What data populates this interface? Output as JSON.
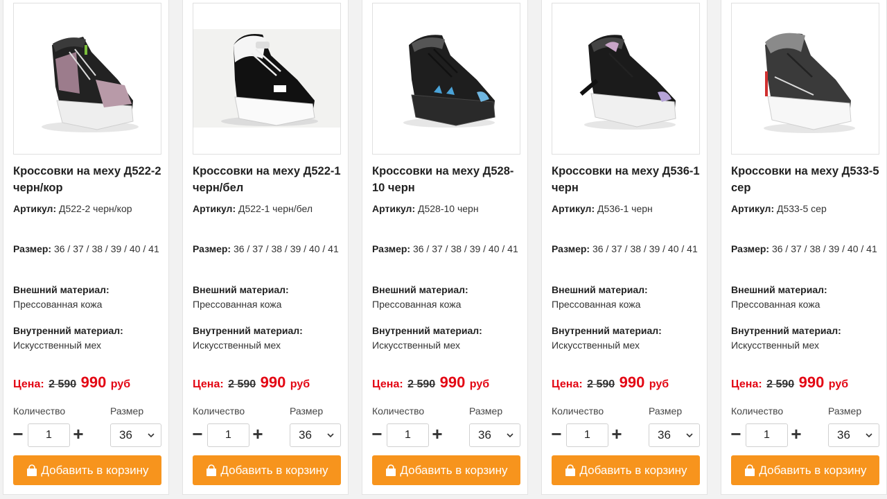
{
  "labels": {
    "article": "Артикул:",
    "size": "Размер:",
    "outer": "Внешний материал:",
    "inner": "Внутренний материал:",
    "price": "Цена:",
    "currency": "руб",
    "quantity": "Количество",
    "size_select": "Размер",
    "add_to_cart": "Добавить в корзину"
  },
  "colors": {
    "price": "#e30613",
    "button": "#f7941d"
  },
  "products": [
    {
      "title": "Кроссовки на меху Д522-2 черн/кор",
      "article": "Д522-2 черн/кор",
      "sizes": "36 / 37 / 38 / 39 / 40 / 41",
      "outer": "Прессованная кожа",
      "inner": "Искусственный мех",
      "old_price": "2 590",
      "new_price": "990",
      "quantity": "1",
      "selected_size": "36",
      "image_icon": "sneaker-photo"
    },
    {
      "title": "Кроссовки на меху Д522-1 черн/бел",
      "article": "Д522-1 черн/бел",
      "sizes": "36 / 37 / 38 / 39 / 40 / 41",
      "outer": "Прессованная кожа",
      "inner": "Искусственный мех",
      "old_price": "2 590",
      "new_price": "990",
      "quantity": "1",
      "selected_size": "36",
      "image_icon": "sneaker-photo"
    },
    {
      "title": "Кроссовки на меху Д528-10 черн",
      "article": "Д528-10 черн",
      "sizes": "36 / 37 / 38 / 39 / 40 / 41",
      "outer": "Прессованная кожа",
      "inner": "Искусственный мех",
      "old_price": "2 590",
      "new_price": "990",
      "quantity": "1",
      "selected_size": "36",
      "image_icon": "sneaker-photo"
    },
    {
      "title": "Кроссовки на меху Д536-1 черн",
      "article": "Д536-1 черн",
      "sizes": "36 / 37 / 38 / 39 / 40 / 41",
      "outer": "Прессованная кожа",
      "inner": "Искусственный мех",
      "old_price": "2 590",
      "new_price": "990",
      "quantity": "1",
      "selected_size": "36",
      "image_icon": "sneaker-photo"
    },
    {
      "title": "Кроссовки на меху Д533-5 сер",
      "article": "Д533-5 сер",
      "sizes": "36 / 37 / 38 / 39 / 40 / 41",
      "outer": "Прессованная кожа",
      "inner": "Искусственный мех",
      "old_price": "2 590",
      "new_price": "990",
      "quantity": "1",
      "selected_size": "36",
      "image_icon": "sneaker-photo"
    }
  ]
}
